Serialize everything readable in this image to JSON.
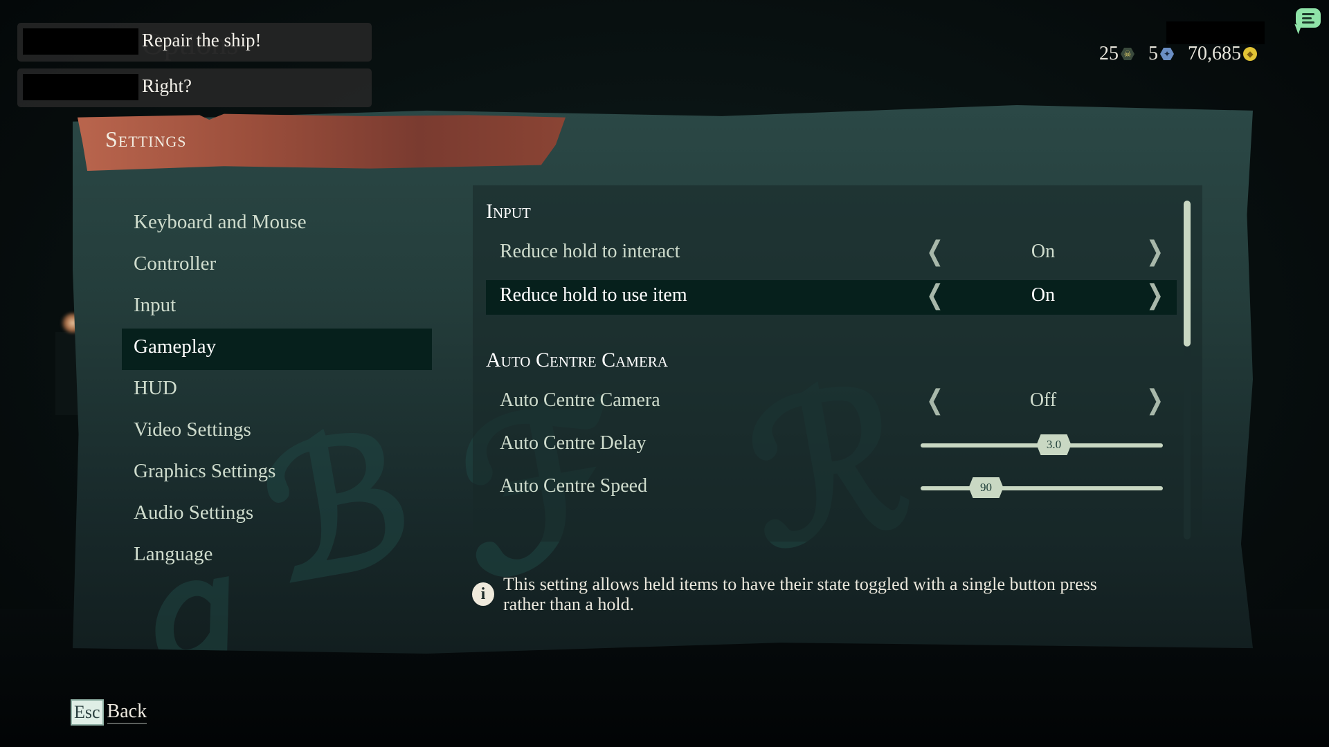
{
  "background": {
    "ghost_title": "Options"
  },
  "chat": {
    "messages": [
      {
        "text": "Repair the ship!"
      },
      {
        "text": "Right?"
      }
    ]
  },
  "currencies": [
    {
      "value": "25",
      "icon": "doubloon-icon",
      "glyph": "☠"
    },
    {
      "value": "5",
      "icon": "ancient-coin-icon",
      "glyph": "✦"
    },
    {
      "value": "70,685",
      "icon": "gold-coin-icon",
      "glyph": "◆"
    }
  ],
  "header": {
    "title": "Settings"
  },
  "sidebar": {
    "items": [
      {
        "label": "Keyboard and Mouse",
        "active": false
      },
      {
        "label": "Controller",
        "active": false
      },
      {
        "label": "Input",
        "active": false
      },
      {
        "label": "Gameplay",
        "active": true
      },
      {
        "label": "HUD",
        "active": false
      },
      {
        "label": "Video Settings",
        "active": false
      },
      {
        "label": "Graphics Settings",
        "active": false
      },
      {
        "label": "Audio Settings",
        "active": false
      },
      {
        "label": "Language",
        "active": false
      }
    ]
  },
  "content": {
    "sections": [
      {
        "title": "Input",
        "settings": [
          {
            "label": "Reduce hold to interact",
            "type": "toggle",
            "value": "On",
            "selected": false
          },
          {
            "label": "Reduce hold to use item",
            "type": "toggle",
            "value": "On",
            "selected": true
          }
        ]
      },
      {
        "title": "Auto Centre Camera",
        "settings": [
          {
            "label": "Auto Centre Camera",
            "type": "toggle",
            "value": "Off",
            "selected": false
          },
          {
            "label": "Auto Centre Delay",
            "type": "slider",
            "value": "3.0",
            "fraction": 0.55
          },
          {
            "label": "Auto Centre Speed",
            "type": "slider",
            "value": "90",
            "fraction": 0.27
          }
        ]
      }
    ],
    "arrows": {
      "left": "❮",
      "right": "❯"
    },
    "scroll": {
      "thumb_start": 0.0,
      "thumb_fraction": 0.43
    }
  },
  "info": {
    "icon": "i",
    "text": "This setting allows held items to have their state toggled with a single button press rather than a hold."
  },
  "footer": {
    "key": "Esc",
    "label": "Back"
  }
}
